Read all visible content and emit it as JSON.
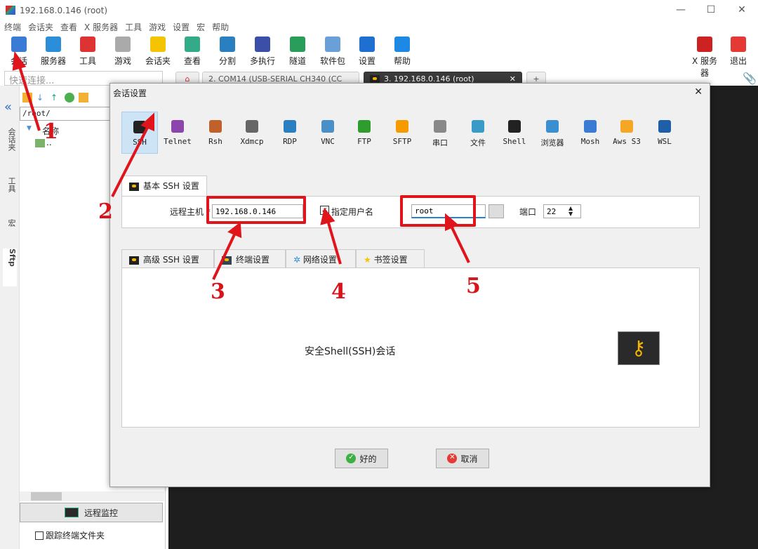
{
  "window": {
    "title": "192.168.0.146 (root)",
    "minimize": "—",
    "maximize": "☐",
    "close": "✕"
  },
  "menu": [
    "终端",
    "会话夹",
    "查看",
    "X 服务器",
    "工具",
    "游戏",
    "设置",
    "宏",
    "帮助"
  ],
  "toolbar": [
    {
      "label": "会话",
      "color": "#3a7bd5"
    },
    {
      "label": "服务器",
      "color": "#2a8fd8"
    },
    {
      "label": "工具",
      "color": "#d33"
    },
    {
      "label": "游戏",
      "color": "#aaa"
    },
    {
      "label": "会话夹",
      "color": "#f5c400"
    },
    {
      "label": "查看",
      "color": "#3a8"
    },
    {
      "label": "分割",
      "color": "#2a7fc0"
    },
    {
      "label": "多执行",
      "color": "#3b4fa8"
    },
    {
      "label": "隧道",
      "color": "#2a9d5a"
    },
    {
      "label": "软件包",
      "color": "#6aa0d8"
    },
    {
      "label": "设置",
      "color": "#1e6fd0"
    },
    {
      "label": "帮助",
      "color": "#1e88e5"
    }
  ],
  "toolbar_right": [
    {
      "label": "X 服务器",
      "color": "#c22"
    },
    {
      "label": "退出",
      "color": "#e53935"
    }
  ],
  "quick_connect": {
    "placeholder": "快速连接..."
  },
  "tabs": [
    {
      "label": "2. COM14  (USB-SERIAL CH340 (CC"
    },
    {
      "label": "3. 192.168.0.146 (root)",
      "close": "✕"
    }
  ],
  "side_tabs": [
    "会话夹",
    "工具",
    "宏",
    "Sftp"
  ],
  "file_pane": {
    "path": "/root/",
    "header": "名称",
    "items": [
      ".."
    ],
    "remote_monitor": "远程监控",
    "follow_label": "跟踪终端文件夹"
  },
  "dialog": {
    "title": "会话设置",
    "close": "✕",
    "protocols": [
      {
        "label": "SSH",
        "color": "#222"
      },
      {
        "label": "Telnet",
        "color": "#8e44ad"
      },
      {
        "label": "Rsh",
        "color": "#c0602a"
      },
      {
        "label": "Xdmcp",
        "color": "#666"
      },
      {
        "label": "RDP",
        "color": "#2a7fc0"
      },
      {
        "label": "VNC",
        "color": "#4a90c8"
      },
      {
        "label": "FTP",
        "color": "#2e9d2e"
      },
      {
        "label": "SFTP",
        "color": "#f59b00"
      },
      {
        "label": "串口",
        "color": "#888"
      },
      {
        "label": "文件",
        "color": "#3a9ac8"
      },
      {
        "label": "Shell",
        "color": "#222"
      },
      {
        "label": "浏览器",
        "color": "#3a8fd0"
      },
      {
        "label": "Mosh",
        "color": "#3a7bd5"
      },
      {
        "label": "Aws S3",
        "color": "#f5a623"
      },
      {
        "label": "WSL",
        "color": "#1e5fa8"
      }
    ],
    "basic_tab": "基本 SSH 设置",
    "host_label": "远程主机 *",
    "host_value": "192.168.0.146",
    "user_check_label": "指定用户名",
    "user_checked": true,
    "user_value": "root",
    "port_label": "端口",
    "port_value": "22",
    "sub_tabs": [
      "高级 SSH 设置",
      "终端设置",
      "网络设置",
      "书签设置"
    ],
    "description": "安全Shell(SSH)会话",
    "ok": "好的",
    "cancel": "取消"
  },
  "annotations": [
    "1",
    "2",
    "3",
    "4",
    "5"
  ],
  "colors": {
    "annotation": "#e0141b",
    "selected": "#cde4f7",
    "terminal": "#1e1e1e"
  }
}
